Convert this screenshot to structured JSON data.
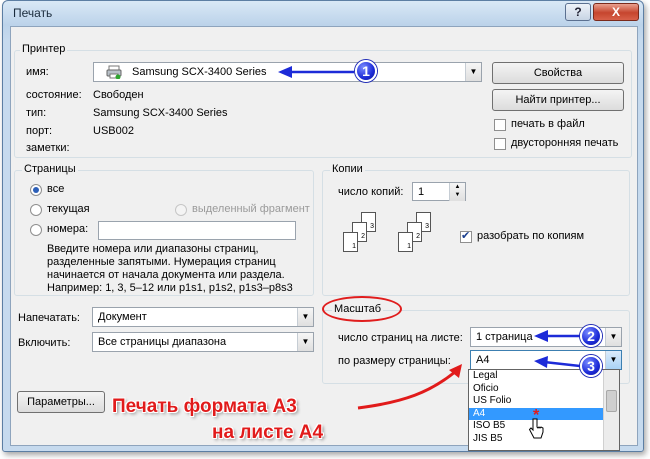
{
  "window": {
    "title": "Печать",
    "help": "?",
    "close": "X"
  },
  "printer": {
    "group_label": "Принтер",
    "name_label": "имя:",
    "name_value": "Samsung SCX-3400 Series",
    "status_label": "состояние:",
    "status_value": "Свободен",
    "type_label": "тип:",
    "type_value": "Samsung SCX-3400 Series",
    "port_label": "порт:",
    "port_value": "USB002",
    "notes_label": "заметки:",
    "properties_button": "Свойства",
    "find_printer_button": "Найти принтер...",
    "print_to_file": "печать в файл",
    "duplex": "двусторонняя печать"
  },
  "pages": {
    "group_label": "Страницы",
    "all": "все",
    "current": "текущая",
    "selection": "выделенный фрагмент",
    "numbers": "номера:",
    "hint_lines": [
      "Введите номера или диапазоны страниц,",
      "разделенные запятыми. Нумерация страниц",
      "начинается от начала документа или раздела.",
      "Например: 1, 3, 5–12 или p1s1, p1s2, p1s3–p8s3"
    ]
  },
  "copies": {
    "group_label": "Копии",
    "count_label": "число копий:",
    "count_value": "1",
    "collate": "разобрать по копиям",
    "icon_numbers": [
      "1",
      "2",
      "3"
    ]
  },
  "print_what": {
    "label": "Напечатать:",
    "value": "Документ"
  },
  "include": {
    "label": "Включить:",
    "value": "Все страницы диапазона"
  },
  "zoom": {
    "group_label": "Масштаб",
    "pages_per_sheet_label": "число страниц на листе:",
    "pages_per_sheet_value": "1 страница",
    "scale_to_paper_label": "по размеру страницы:",
    "scale_to_paper_value": "A4",
    "paper_options": [
      "Legal",
      "Oficio",
      "US Folio",
      "A4",
      "ISO B5",
      "JIS B5"
    ],
    "selected_option": "A4"
  },
  "params_button": "Параметры...",
  "annotations": {
    "badges": [
      "1",
      "2",
      "3"
    ],
    "callout_line1": "Печать формата А3",
    "callout_line2": "на листе А4",
    "accent_color": "#e11b1b",
    "badge_color": "#1d2bd8"
  }
}
